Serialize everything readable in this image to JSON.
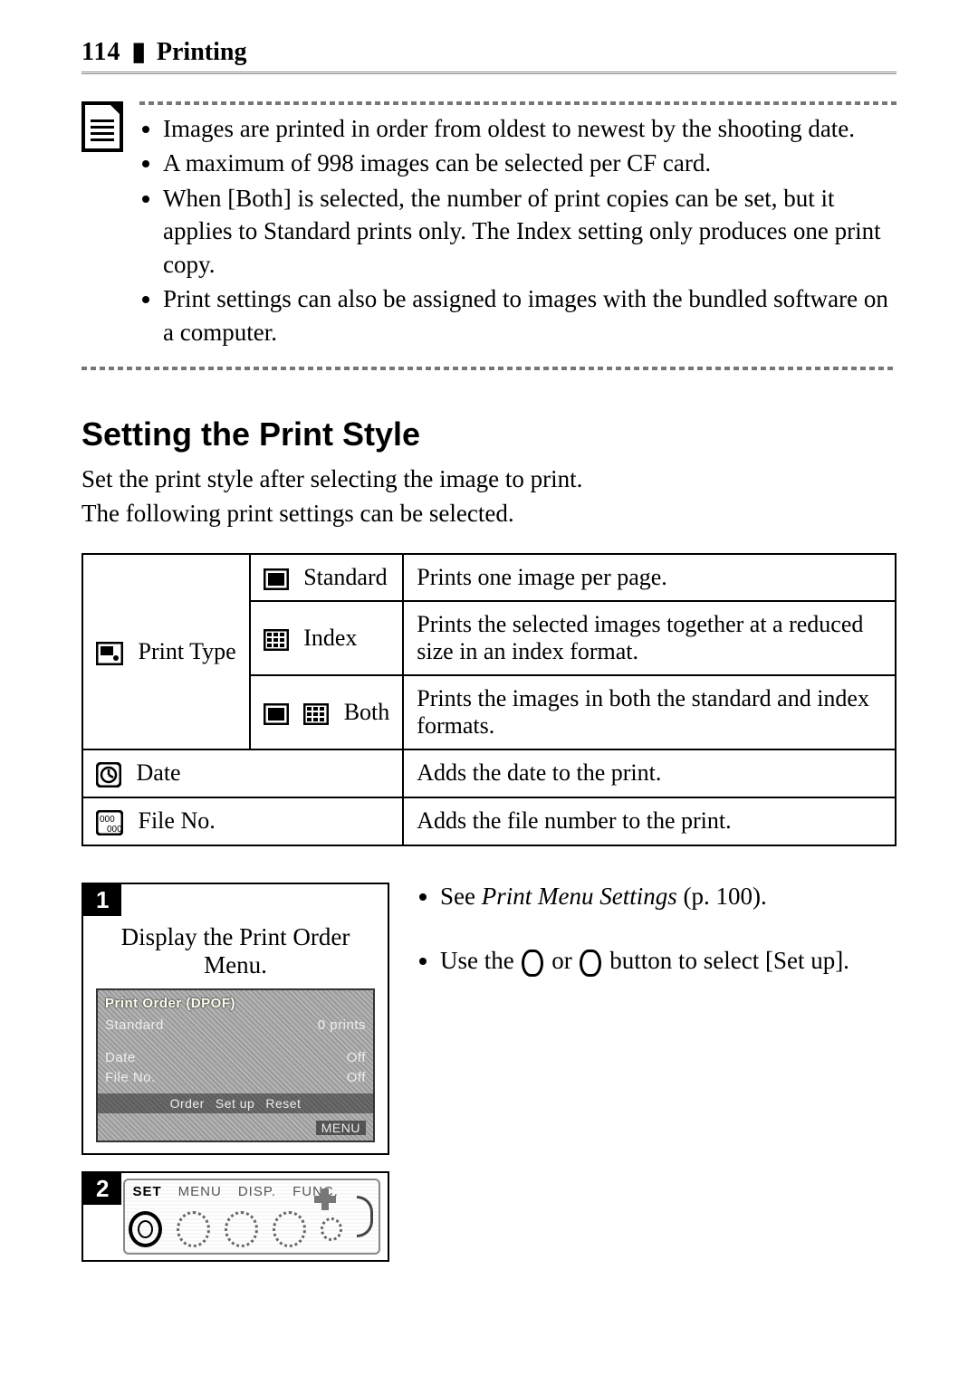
{
  "page": {
    "number": "114",
    "section": "Printing"
  },
  "notes": [
    "Images are printed in order from oldest to newest by the shooting date.",
    "A maximum of 998 images can be selected per CF card.",
    "When [Both] is selected, the number of print copies can be set, but it applies to Standard prints only. The Index setting only produces one print copy.",
    "Print settings can also be assigned to images with the bundled software on a computer."
  ],
  "heading": "Setting the Print Style",
  "lead1": "Set the print style after selecting the image to print.",
  "lead2": "The following print settings can be selected.",
  "table": {
    "print_type_label": "Print Type",
    "rows": {
      "standard": {
        "name": "Standard",
        "desc": "Prints one image per page."
      },
      "index": {
        "name": "Index",
        "desc": "Prints the selected images together at a reduced size in an index format."
      },
      "both": {
        "name": "Both",
        "desc": "Prints the images in both the standard and index formats."
      }
    },
    "date": {
      "name": "Date",
      "desc": "Adds the date to the print."
    },
    "fileno": {
      "name": "File No.",
      "desc": "Adds the file number to the print."
    }
  },
  "steps": {
    "s1": {
      "num": "1",
      "title": "Display the Print Order Menu.",
      "lcd": {
        "title": "Print Order (DPOF)",
        "r1l": "Standard",
        "r1r": "0 prints",
        "r2l": "Date",
        "r2r": "Off",
        "r3l": "File No.",
        "r3r": "Off",
        "bar_items": [
          "Order",
          "Set up",
          "Reset"
        ],
        "menu": "MENU"
      }
    },
    "s2": {
      "num": "2",
      "labels": [
        "SET",
        "MENU",
        "DISP.",
        "FUNC."
      ]
    }
  },
  "instr": {
    "i1a": "See ",
    "i1b": "Print Menu Settings",
    "i1c": " (p. 100).",
    "i2a": "Use the ",
    "i2b": " or ",
    "i2c": " button to select [Set up]."
  }
}
